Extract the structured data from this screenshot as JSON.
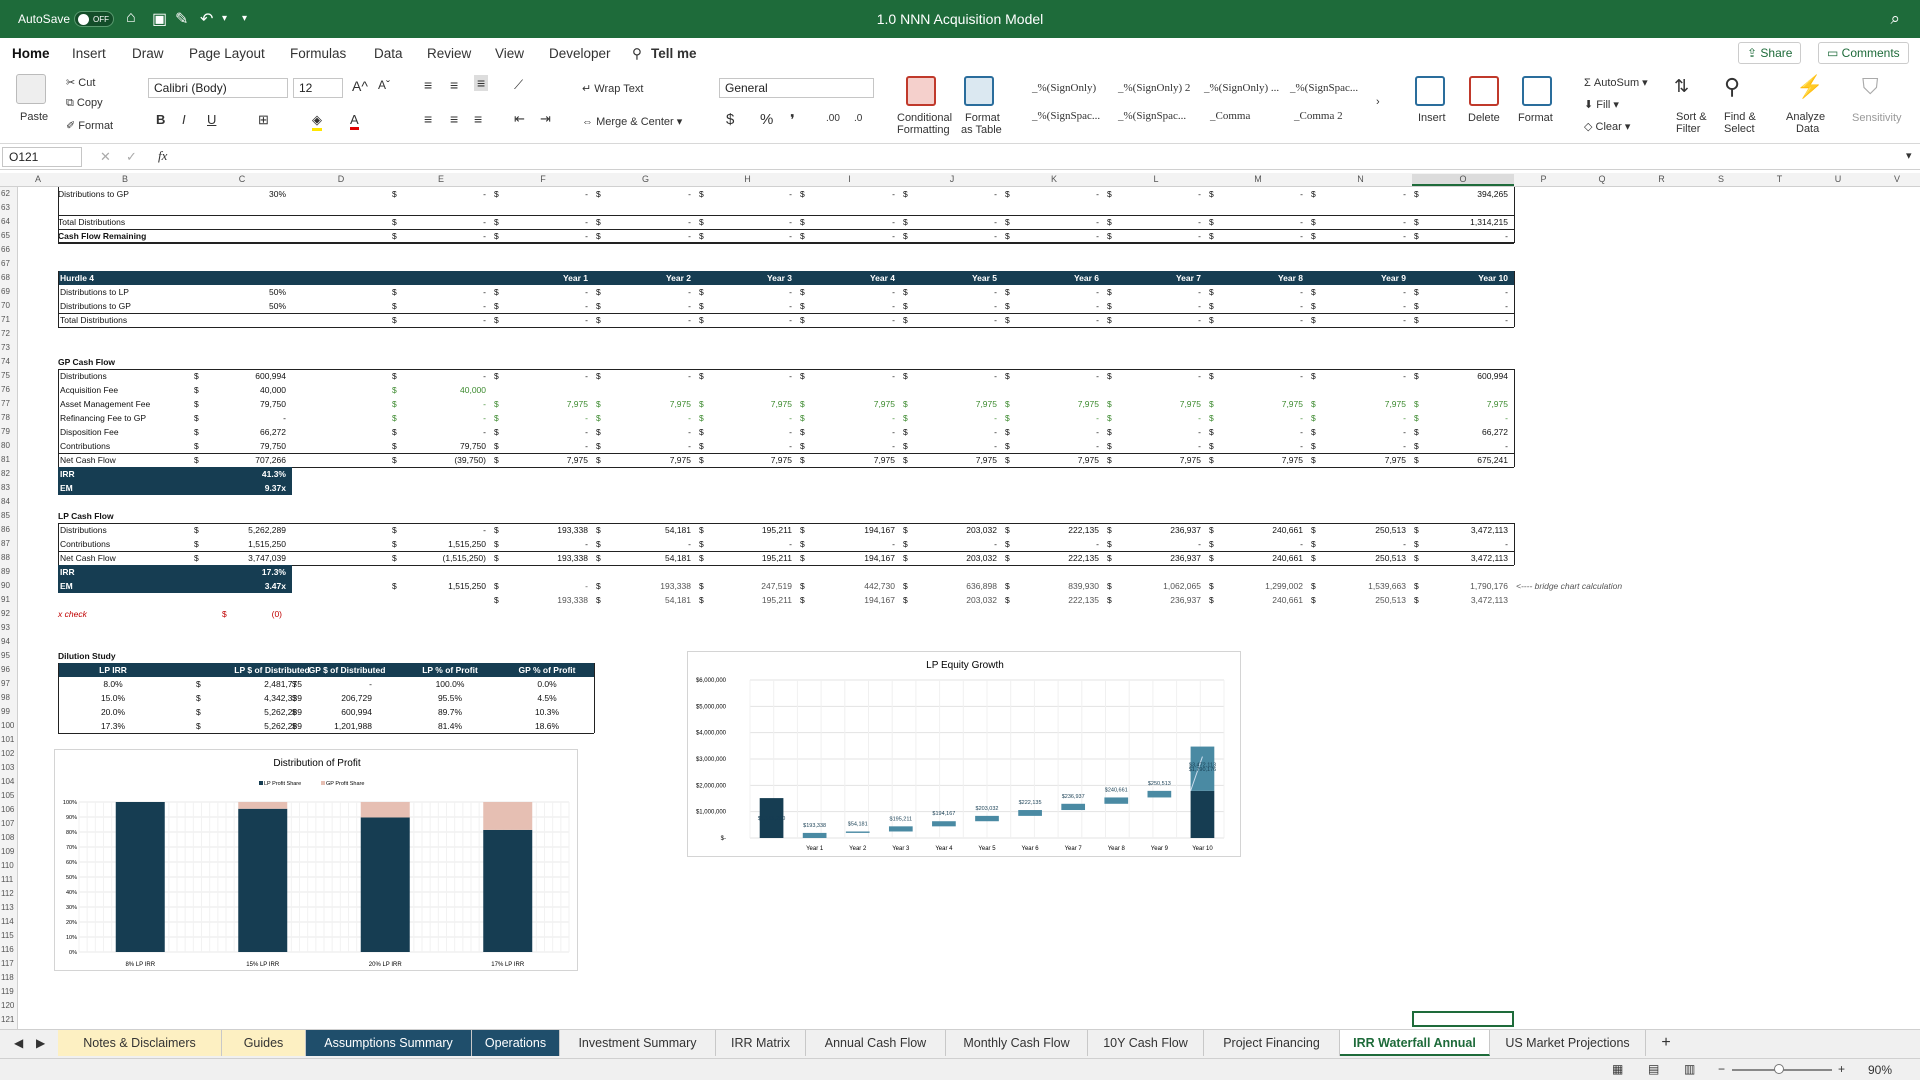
{
  "app": {
    "autosave_label": "AutoSave",
    "autosave_state": "OFF",
    "doc_title": "1.0 NNN Acquisition Model"
  },
  "ribbon_tabs": [
    "Home",
    "Insert",
    "Draw",
    "Page Layout",
    "Formulas",
    "Data",
    "Review",
    "View",
    "Developer",
    "Tell me"
  ],
  "share_label": "Share",
  "comments_label": "Comments",
  "ribbon": {
    "paste": "Paste",
    "cut": "Cut",
    "copy": "Copy",
    "format": "Format",
    "font": "Calibri (Body)",
    "size": "12",
    "wrap": "Wrap Text",
    "merge": "Merge & Center",
    "number_format": "General",
    "cond_fmt_1": "Conditional",
    "cond_fmt_2": "Formatting",
    "fmt_table_1": "Format",
    "fmt_table_2": "as Table",
    "styles": [
      "_%(SignOnly)",
      "_%(SignOnly) 2",
      "_%(SignOnly) ...",
      "_%(SignSpac...",
      "_%(SignSpac...",
      "_%(SignSpac...",
      "_Comma",
      "_Comma 2"
    ],
    "insert": "Insert",
    "delete": "Delete",
    "format_cells": "Format",
    "autosum": "AutoSum",
    "fill": "Fill",
    "clear": "Clear",
    "sort_1": "Sort &",
    "sort_2": "Filter",
    "find_1": "Find &",
    "find_2": "Select",
    "analyze_1": "Analyze",
    "analyze_2": "Data",
    "sensitivity": "Sensitivity"
  },
  "formula_bar": {
    "name_box": "O121",
    "fx": "fx",
    "value": ""
  },
  "columns": [
    "A",
    "B",
    "C",
    "D",
    "E",
    "F",
    "G",
    "H",
    "I",
    "J",
    "K",
    "L",
    "M",
    "N",
    "O",
    "P",
    "Q",
    "R",
    "S",
    "T",
    "U",
    "V"
  ],
  "rows": {
    "start": 62,
    "end": 121
  },
  "sheet": {
    "r62": {
      "label": "Distributions to GP",
      "pct": "30%",
      "o": "394,265"
    },
    "r64": {
      "label": "Total Distributions",
      "o": "1,314,215"
    },
    "r65": {
      "label": "Cash Flow Remaining"
    },
    "h4": {
      "title": "Hurdle 4",
      "years": [
        "Year 1",
        "Year 2",
        "Year 3",
        "Year 4",
        "Year 5",
        "Year 6",
        "Year 7",
        "Year 8",
        "Year 9",
        "Year 10"
      ],
      "lp": "Distributions to LP",
      "lp_pct": "50%",
      "gp": "Distributions to GP",
      "gp_pct": "50%",
      "total": "Total Distributions"
    },
    "gp": {
      "title": "GP Cash Flow",
      "rows": [
        {
          "label": "Distributions",
          "c": "600,994",
          "e": "-",
          "vals": [
            "-",
            "-",
            "-",
            "-",
            "-",
            "-",
            "-",
            "-",
            "-",
            "600,994"
          ]
        },
        {
          "label": "Acquisition Fee",
          "c": "40,000",
          "e": "40,000",
          "vals": [
            "",
            "",
            "",
            "",
            "",
            "",
            "",
            "",
            "",
            ""
          ]
        },
        {
          "label": "Asset Management Fee",
          "c": "79,750",
          "e": "-",
          "vals": [
            "7,975",
            "7,975",
            "7,975",
            "7,975",
            "7,975",
            "7,975",
            "7,975",
            "7,975",
            "7,975",
            "7,975"
          ]
        },
        {
          "label": "Refinancing Fee to GP",
          "c": "-",
          "e": "-",
          "vals": [
            "-",
            "-",
            "-",
            "-",
            "-",
            "-",
            "-",
            "-",
            "-",
            "-"
          ]
        },
        {
          "label": "Disposition Fee",
          "c": "66,272",
          "e": "-",
          "vals": [
            "-",
            "-",
            "-",
            "-",
            "-",
            "-",
            "-",
            "-",
            "-",
            "66,272"
          ]
        },
        {
          "label": "Contributions",
          "c": "79,750",
          "e": "79,750",
          "vals": [
            "-",
            "-",
            "-",
            "-",
            "-",
            "-",
            "-",
            "-",
            "-",
            "-"
          ]
        },
        {
          "label": "Net Cash Flow",
          "c": "707,266",
          "e": "(39,750)",
          "vals": [
            "7,975",
            "7,975",
            "7,975",
            "7,975",
            "7,975",
            "7,975",
            "7,975",
            "7,975",
            "7,975",
            "675,241"
          ]
        }
      ],
      "irr_label": "IRR",
      "irr": "41.3%",
      "em_label": "EM",
      "em": "9.37x"
    },
    "lp": {
      "title": "LP Cash Flow",
      "rows": [
        {
          "label": "Distributions",
          "c": "5,262,289",
          "e": "-",
          "vals": [
            "193,338",
            "54,181",
            "195,211",
            "194,167",
            "203,032",
            "222,135",
            "236,937",
            "240,661",
            "250,513",
            "3,472,113"
          ]
        },
        {
          "label": "Contributions",
          "c": "1,515,250",
          "e": "1,515,250",
          "vals": [
            "-",
            "-",
            "-",
            "-",
            "-",
            "-",
            "-",
            "-",
            "-",
            "-"
          ]
        },
        {
          "label": "Net Cash Flow",
          "c": "3,747,039",
          "e": "(1,515,250)",
          "vals": [
            "193,338",
            "54,181",
            "195,211",
            "194,167",
            "203,032",
            "222,135",
            "236,937",
            "240,661",
            "250,513",
            "3,472,113"
          ]
        }
      ],
      "irr_label": "IRR",
      "irr": "17.3%",
      "em_label": "EM",
      "em": "3.47x"
    },
    "r90": {
      "e": "1,515,250",
      "vals": [
        "-",
        "193,338",
        "247,519",
        "442,730",
        "636,898",
        "839,930",
        "1,062,065",
        "1,299,002",
        "1,539,663",
        "1,790,176"
      ],
      "note": "<---- bridge chart calculation"
    },
    "r91": {
      "vals": [
        "193,338",
        "54,181",
        "195,211",
        "194,167",
        "203,032",
        "222,135",
        "236,937",
        "240,661",
        "250,513",
        "3,472,113"
      ]
    },
    "xcheck": {
      "label": "x check",
      "cur": "$",
      "val": "(0)"
    },
    "dilution": {
      "title": "Dilution Study",
      "headers": [
        "LP IRR",
        "LP $ of Distributed",
        "GP $ of Distributed",
        "LP % of Profit",
        "GP % of Profit"
      ],
      "rows": [
        [
          "8.0%",
          "2,481,775",
          "-",
          "100.0%",
          "0.0%"
        ],
        [
          "15.0%",
          "4,342,339",
          "206,729",
          "95.5%",
          "4.5%"
        ],
        [
          "20.0%",
          "5,262,289",
          "600,994",
          "89.7%",
          "10.3%"
        ],
        [
          "17.3%",
          "5,262,289",
          "1,201,988",
          "81.4%",
          "18.6%"
        ]
      ]
    },
    "dollar": "$"
  },
  "chart_data": [
    {
      "type": "bar",
      "title": "LP Equity Growth",
      "categories": [
        "",
        "Year 1",
        "Year 2",
        "Year 3",
        "Year 4",
        "Year 5",
        "Year 6",
        "Year 7",
        "Year 8",
        "Year 9",
        "Year 10"
      ],
      "series": [
        {
          "values": [
            1515250,
            193338,
            54181,
            195211,
            194167,
            203032,
            222135,
            236937,
            240661,
            250513,
            3472113
          ],
          "bases": [
            0,
            0,
            193338,
            247519,
            442730,
            636898,
            839930,
            1062065,
            1299002,
            1539663,
            1790176
          ]
        }
      ],
      "data_labels": [
        "$1,515,250",
        "$193,338",
        "$54,181",
        "$195,211",
        "$194,167",
        "$203,032",
        "$222,135",
        "$236,937",
        "$240,661",
        "$250,513",
        "$3,472,113"
      ],
      "extra_label": "$1,790,176",
      "ylim": [
        0,
        6000000
      ],
      "yticks": [
        "$-",
        "$1,000,000",
        "$2,000,000",
        "$3,000,000",
        "$4,000,000",
        "$5,000,000",
        "$6,000,000"
      ],
      "colors": {
        "first": "#163d52",
        "float": "#4a8aa3",
        "final_top": "#4a8aa3",
        "final_base": "#163d52"
      },
      "grid": true
    },
    {
      "type": "bar",
      "stacked": true,
      "title": "Distribution of Profit",
      "categories": [
        "8%  LP IRR",
        "15%  LP IRR",
        "20%  LP IRR",
        "17%  LP IRR"
      ],
      "series": [
        {
          "name": "LP Profit Share",
          "values": [
            100.0,
            95.5,
            89.7,
            81.4
          ],
          "color": "#163d52"
        },
        {
          "name": "GP Profit Share",
          "values": [
            0.0,
            4.5,
            10.3,
            18.6
          ],
          "color": "#e6bfb3"
        }
      ],
      "yticks": [
        "0%",
        "10%",
        "20%",
        "30%",
        "40%",
        "50%",
        "60%",
        "70%",
        "80%",
        "90%",
        "100%"
      ],
      "ylim": [
        0,
        100
      ],
      "legend": "top",
      "grid": true
    }
  ],
  "sheet_tabs": [
    {
      "label": "Notes & Disclaimers",
      "style": "beige"
    },
    {
      "label": "Guides",
      "style": "beige"
    },
    {
      "label": "Assumptions Summary",
      "style": "teal"
    },
    {
      "label": "Operations",
      "style": "teal"
    },
    {
      "label": "Investment Summary",
      "style": "plain"
    },
    {
      "label": "IRR Matrix",
      "style": "plain"
    },
    {
      "label": "Annual Cash Flow",
      "style": "plain"
    },
    {
      "label": "Monthly Cash Flow",
      "style": "plain"
    },
    {
      "label": "10Y Cash Flow",
      "style": "plain"
    },
    {
      "label": "Project Financing",
      "style": "plain"
    },
    {
      "label": "IRR Waterfall Annual",
      "style": "active"
    },
    {
      "label": "US Market Projections",
      "style": "plain"
    }
  ],
  "add_sheet": "+",
  "status": {
    "zoom": "90%"
  }
}
